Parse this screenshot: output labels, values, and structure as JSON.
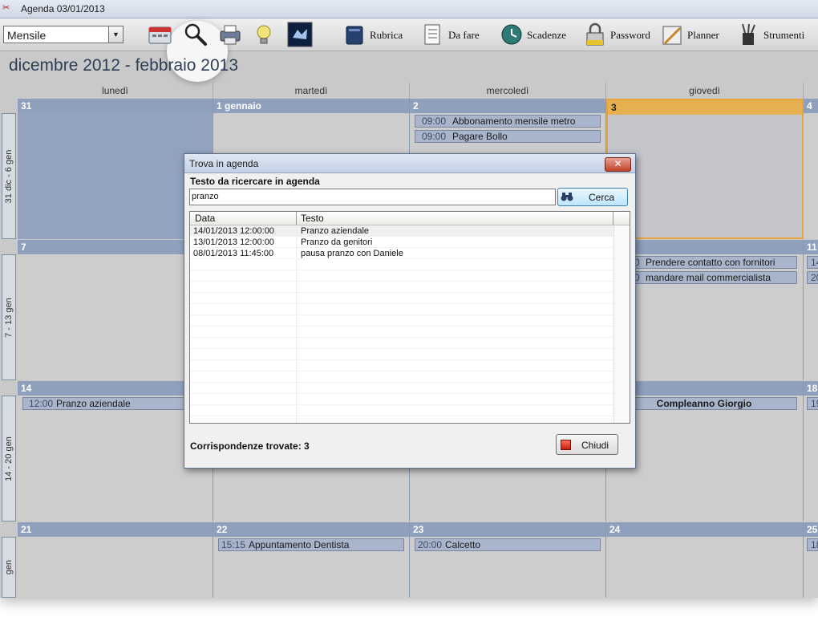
{
  "window": {
    "title": "Agenda 03/01/2013"
  },
  "toolbar": {
    "view_select": "Mensile",
    "buttons": [
      {
        "label": "Rubrica"
      },
      {
        "label": "Da fare"
      },
      {
        "label": "Scadenze"
      },
      {
        "label": "Password"
      },
      {
        "label": "Planner"
      },
      {
        "label": "Strumenti"
      }
    ],
    "icons": [
      "calendar-icon",
      "search-icon",
      "printer-icon",
      "lightbulb-icon",
      "logo-icon",
      "book-icon",
      "checklist-icon",
      "clock-icon",
      "padlock-icon",
      "planner-icon",
      "tools-icon"
    ]
  },
  "calendar": {
    "range_title": "dicembre 2012 - febbraio 2013",
    "day_headers": [
      "lunedì",
      "martedì",
      "mercoledì",
      "giovedì"
    ],
    "weeks": [
      {
        "label": "31 dic - 6 gen",
        "days": [
          {
            "date": "31",
            "events": []
          },
          {
            "date": "1 gennaio",
            "events": []
          },
          {
            "date": "2",
            "events": [
              {
                "time": "09:00",
                "text": "Abbonamento mensile metro"
              },
              {
                "time": "09:00",
                "text": "Pagare Bollo"
              }
            ]
          },
          {
            "date": "3",
            "events": []
          },
          {
            "date": "4",
            "events": []
          }
        ]
      },
      {
        "label": "7 - 13 gen",
        "days": [
          {
            "date": "7",
            "events": []
          },
          {
            "date": "",
            "events": []
          },
          {
            "date": "",
            "events": []
          },
          {
            "date": "",
            "events": [
              {
                "time": "",
                "text": "Prendere contatto con fornitori",
                "partial_time": "0"
              },
              {
                "time": "",
                "text": "mandare mail commercialista",
                "partial_time": "0"
              }
            ]
          },
          {
            "date": "11",
            "events": [
              {
                "text": "14"
              },
              {
                "text": "20"
              }
            ]
          }
        ]
      },
      {
        "label": "14 - 20 gen",
        "days": [
          {
            "date": "14",
            "events": [
              {
                "time": "12:00",
                "text": "Pranzo aziendale"
              }
            ]
          },
          {
            "date": "",
            "events": []
          },
          {
            "date": "",
            "events": []
          },
          {
            "date": "",
            "events": [
              {
                "time": "",
                "text": "Compleanno Giorgio"
              }
            ]
          },
          {
            "date": "18",
            "events": [
              {
                "text": "19"
              }
            ]
          }
        ]
      },
      {
        "label": "gen",
        "days": [
          {
            "date": "21",
            "events": []
          },
          {
            "date": "22",
            "events": [
              {
                "time": "15:15",
                "text": "Appuntamento Dentista"
              }
            ]
          },
          {
            "date": "23",
            "events": [
              {
                "time": "20:00",
                "text": "Calcetto"
              }
            ]
          },
          {
            "date": "24",
            "events": []
          },
          {
            "date": "25",
            "events": [
              {
                "text": "18"
              }
            ]
          }
        ]
      }
    ]
  },
  "dialog": {
    "title": "Trova in agenda",
    "close_glyph": "✕",
    "search_label": "Testo da ricercare in agenda",
    "search_value": "pranzo",
    "search_button": "Cerca",
    "columns": [
      "Data",
      "Testo"
    ],
    "results": [
      {
        "data": "14/01/2013 12:00:00",
        "testo": "Pranzo aziendale"
      },
      {
        "data": "13/01/2013 12:00:00",
        "testo": "Pranzo da genitori"
      },
      {
        "data": "08/01/2013 11:45:00",
        "testo": "pausa pranzo con Daniele"
      }
    ],
    "matches_label": "Corrispondenze trovate:",
    "matches_count": "3",
    "close_button": "Chiudi"
  },
  "colors": {
    "accent_header": "#8fa0bc",
    "today_border": "#e9a43c",
    "event_bg": "#a9b5cb",
    "close_red": "#c2402a"
  }
}
